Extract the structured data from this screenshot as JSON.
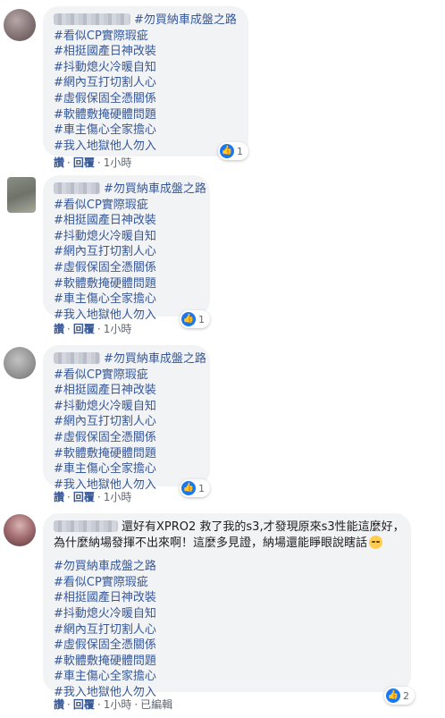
{
  "comments": [
    {
      "lines": [
        "#勿買納車成盤之路",
        "#看似CP實際瑕疵",
        "#相挺國產日神改裝",
        "#抖動熄火冷暖自知",
        "#網內互打切割人心",
        "#虛假保固全憑關係",
        "#軟體敷掩硬體問題",
        "#車主傷心全家擔心",
        "#我入地獄他人勿入"
      ],
      "reaction_count": "1",
      "actions": {
        "like": "讚",
        "reply": "回覆",
        "time": "1小時"
      }
    },
    {
      "lines": [
        "#勿買納車成盤之路",
        "#看似CP實際瑕疵",
        "#相挺國產日神改裝",
        "#抖動熄火冷暖自知",
        "#網內互打切割人心",
        "#虛假保固全憑關係",
        "#軟體敷掩硬體問題",
        "#車主傷心全家擔心",
        "#我入地獄他人勿入"
      ],
      "reaction_count": "1",
      "actions": {
        "like": "讚",
        "reply": "回覆",
        "time": "1小時"
      }
    },
    {
      "lines": [
        "#勿買納車成盤之路",
        "#看似CP實際瑕疵",
        "#相挺國產日神改裝",
        "#抖動熄火冷暖自知",
        "#網內互打切割人心",
        "#虛假保固全憑關係",
        "#軟體敷掩硬體問題",
        "#車主傷心全家擔心",
        "#我入地獄他人勿入"
      ],
      "reaction_count": "1",
      "actions": {
        "like": "讚",
        "reply": "回覆",
        "time": "1小時"
      }
    },
    {
      "intro_line1": "還好有XPRO2 救了我的s3,才發現原來s3性能這麼好，",
      "intro_line2": "為什麼納場發揮不出來啊！這麼多見證，納場還能睜眼說瞎話",
      "lines": [
        "#勿買納車成盤之路",
        "#看似CP實際瑕疵",
        "#相挺國產日神改裝",
        "#抖動熄火冷暖自知",
        "#網內互打切割人心",
        "#虛假保固全憑關係",
        "#軟體敷掩硬體問題",
        "#車主傷心全家擔心",
        "#我入地獄他人勿入"
      ],
      "reaction_count": "2",
      "actions": {
        "like": "讚",
        "reply": "回覆",
        "time": "1小時",
        "edited": "已編輯"
      }
    }
  ],
  "icons": {
    "reaction": "like-icon",
    "emoji": "tired-face-emoji"
  },
  "colors": {
    "bubble": "#f2f3f5",
    "like_blue": "#1877f2",
    "meta_gray": "#606770",
    "action_blue": "#385898"
  }
}
